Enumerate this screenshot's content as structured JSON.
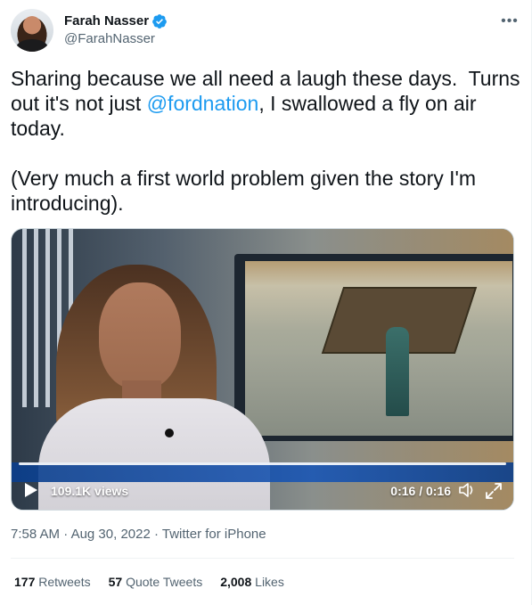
{
  "author": {
    "display_name": "Farah Nasser",
    "handle": "@FarahNasser",
    "verified": true
  },
  "more_menu_glyph": "•••",
  "tweet": {
    "text_before_mention": "Sharing because we all need a laugh these days.  Turns out it's not just ",
    "mention": "@fordnation",
    "text_after_mention": ", I swallowed a fly on air today.\n\n(Very much a first world problem given the story I'm introducing)."
  },
  "video": {
    "views": "109.1K views",
    "time": "0:16 / 0:16"
  },
  "meta": {
    "time": "7:58 AM",
    "date": "Aug 30, 2022",
    "source": "Twitter for iPhone",
    "separator": "·"
  },
  "stats": {
    "retweets_count": "177",
    "retweets_label": "Retweets",
    "quote_tweets_count": "57",
    "quote_tweets_label": "Quote Tweets",
    "likes_count": "2,008",
    "likes_label": "Likes"
  },
  "colors": {
    "accent": "#1d9bf0",
    "secondary_text": "#536471",
    "primary_text": "#0f1419"
  },
  "icons": {
    "verified": "verified-badge-icon",
    "more": "more-horizontal-icon",
    "play": "play-icon",
    "volume": "volume-icon",
    "fullscreen": "fullscreen-icon"
  }
}
